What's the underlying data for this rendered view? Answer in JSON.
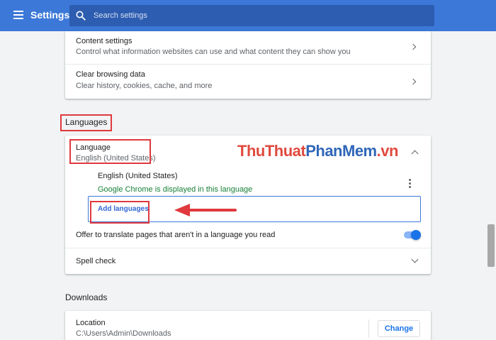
{
  "header": {
    "title": "Settings",
    "search_placeholder": "Search settings"
  },
  "privacy": {
    "content_settings": {
      "title": "Content settings",
      "subtitle": "Control what information websites can use and what content they can show you"
    },
    "clear_browsing": {
      "title": "Clear browsing data",
      "subtitle": "Clear history, cookies, cache, and more"
    }
  },
  "languages": {
    "heading": "Languages",
    "language_row": {
      "title": "Language",
      "subtitle": "English (United States)"
    },
    "entry": {
      "name": "English (United States)",
      "status": "Google Chrome is displayed in this language"
    },
    "add_languages_label": "Add languages",
    "translate_offer": "Offer to translate pages that aren't in a language you read",
    "translate_enabled": true,
    "spell_check": "Spell check"
  },
  "downloads": {
    "heading": "Downloads",
    "location_title": "Location",
    "location_path": "C:\\Users\\Admin\\Downloads",
    "change_label": "Change"
  },
  "watermark": {
    "part1": "ThuThuat",
    "part2": "PhanMem",
    "part3": ".vn"
  },
  "colors": {
    "header_bg": "#3c78d8",
    "accent": "#1a73e8",
    "status_green": "#188038",
    "annotation_red": "#e0393e"
  }
}
